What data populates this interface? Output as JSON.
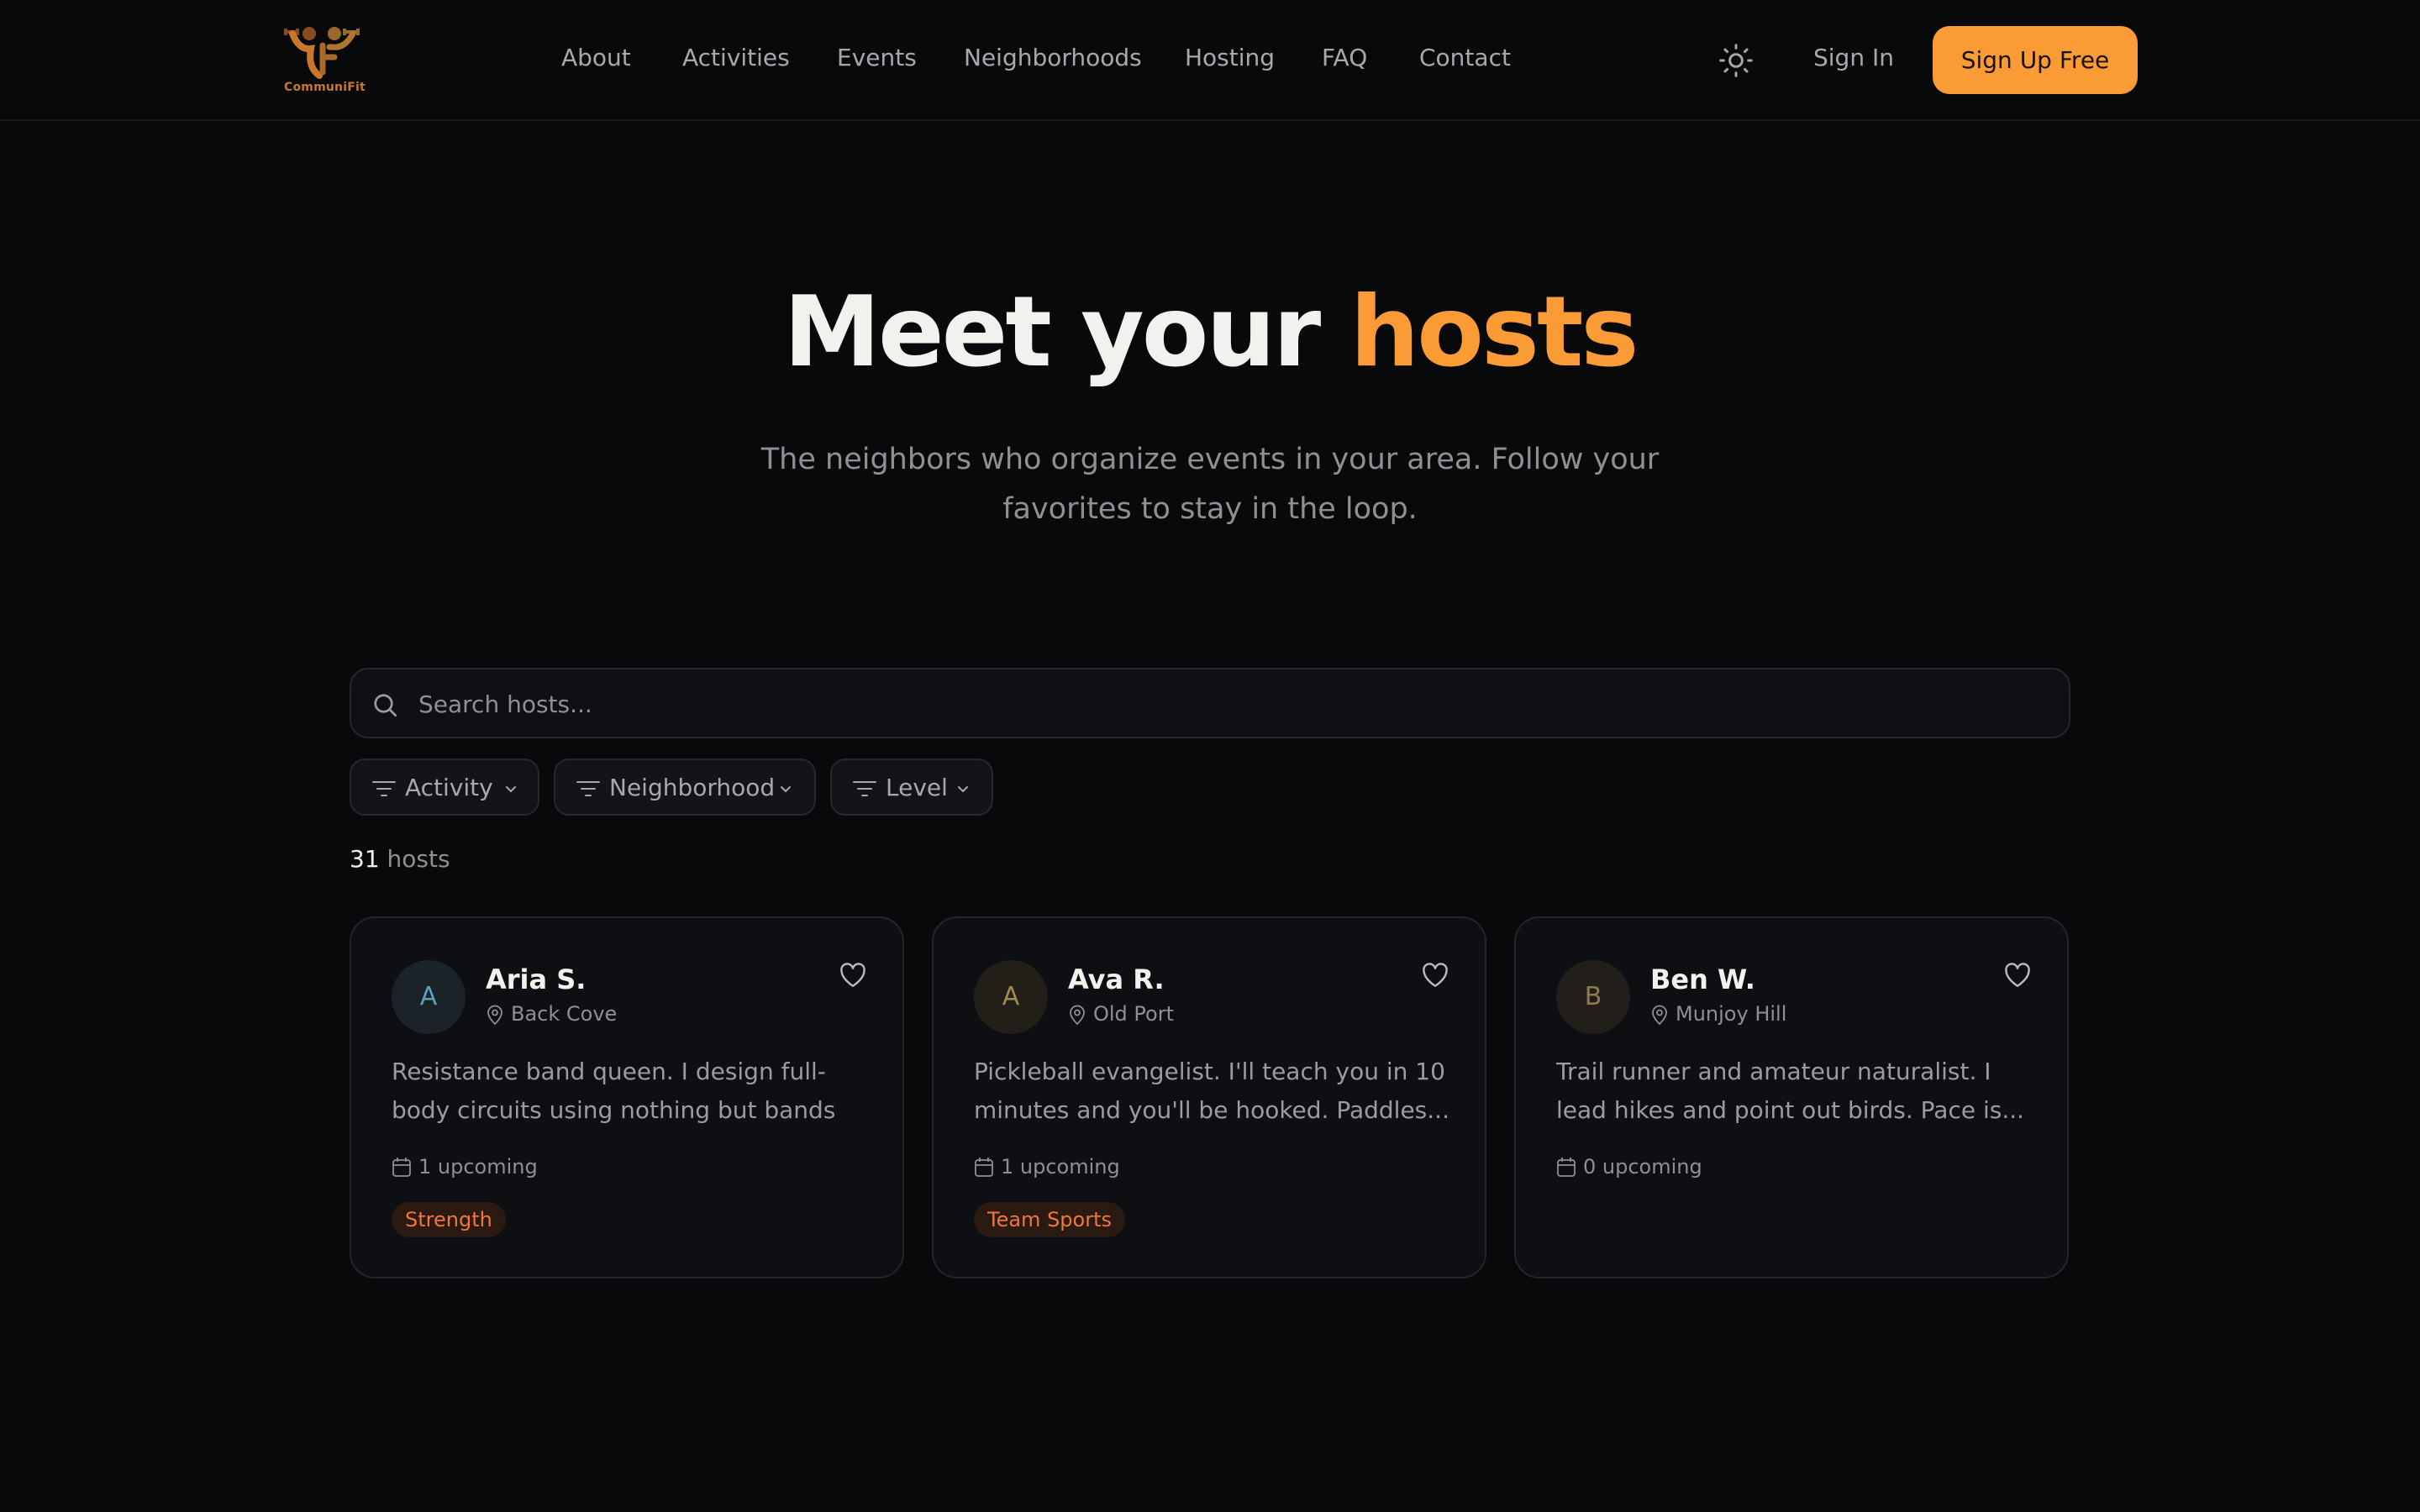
{
  "brand": {
    "name": "CommuniFit",
    "colors": {
      "accent": "#fb9b35",
      "tag_text": "#f0763a",
      "background": "#08090b"
    }
  },
  "nav": {
    "items": [
      {
        "label": "About"
      },
      {
        "label": "Activities"
      },
      {
        "label": "Events"
      },
      {
        "label": "Neighborhoods"
      },
      {
        "label": "Hosting"
      },
      {
        "label": "FAQ"
      },
      {
        "label": "Contact"
      }
    ],
    "theme_icon": "sun-icon",
    "sign_in": "Sign In",
    "sign_up": "Sign Up Free"
  },
  "hero": {
    "title_lead": "Meet your",
    "title_accent": "hosts",
    "subtitle": "The neighbors who organize events in your area. Follow your favorites to stay in the loop."
  },
  "search": {
    "placeholder": "Search hosts...",
    "value": "",
    "icon": "search-icon"
  },
  "filters": [
    {
      "label": "Activity",
      "icon": "filter-icon"
    },
    {
      "label": "Neighborhood",
      "icon": "filter-icon"
    },
    {
      "label": "Level",
      "icon": "filter-icon"
    }
  ],
  "results": {
    "count": "31",
    "label": "hosts"
  },
  "hosts": [
    {
      "initial": "A",
      "name": "Aria S.",
      "neighborhood": "Back Cove",
      "bio": "Resistance band queen. I design full-body circuits using nothing but bands and...",
      "upcoming": "1 upcoming",
      "tag": "Strength",
      "avatar_bg": "#1b2228",
      "avatar_fg": "#5aa3b8"
    },
    {
      "initial": "A",
      "name": "Ava R.",
      "neighborhood": "Old Port",
      "bio": "Pickleball evangelist. I'll teach you in 10 minutes and you'll be hooked. Paddles...",
      "upcoming": "1 upcoming",
      "tag": "Team Sports",
      "avatar_bg": "#221f19",
      "avatar_fg": "#a58a4e"
    },
    {
      "initial": "B",
      "name": "Ben W.",
      "neighborhood": "Munjoy Hill",
      "bio": "Trail runner and amateur naturalist. I lead hikes and point out birds. Pace is...",
      "upcoming": "0 upcoming",
      "tag": "",
      "avatar_bg": "#221f1a",
      "avatar_fg": "#8f7a52"
    }
  ]
}
